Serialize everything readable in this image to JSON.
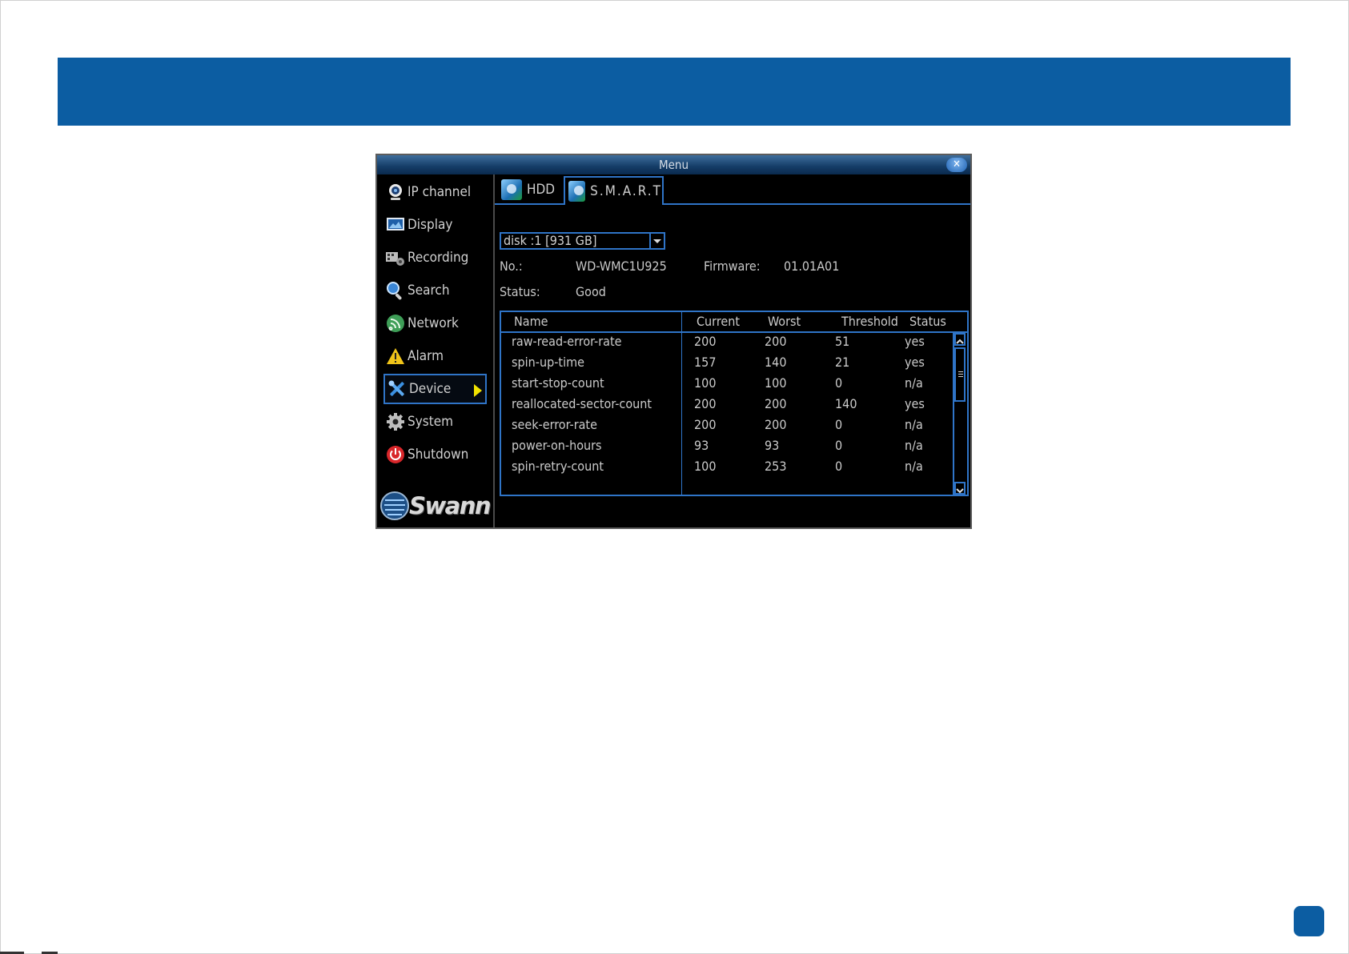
{
  "window": {
    "title": "Menu"
  },
  "sidebar": {
    "items": [
      {
        "label": "IP channel",
        "icon": "webcam-icon"
      },
      {
        "label": "Display",
        "icon": "monitor-icon"
      },
      {
        "label": "Recording",
        "icon": "film-icon"
      },
      {
        "label": "Search",
        "icon": "magnifier-icon"
      },
      {
        "label": "Network",
        "icon": "network-icon"
      },
      {
        "label": "Alarm",
        "icon": "warning-icon"
      },
      {
        "label": "Device",
        "icon": "tools-icon",
        "active": true
      },
      {
        "label": "System",
        "icon": "gear-icon"
      },
      {
        "label": "Shutdown",
        "icon": "power-icon"
      }
    ],
    "logo": "Swann"
  },
  "tabs": [
    {
      "label": "HDD",
      "active": false
    },
    {
      "label": "S.M.A.R.T",
      "active": true
    }
  ],
  "disk_select": {
    "value": "disk :1 [931 GB]"
  },
  "info": {
    "no_label": "No.:",
    "no_value": "WD-WMC1U925",
    "firmware_label": "Firmware:",
    "firmware_value": "01.01A01",
    "status_label": "Status:",
    "status_value": "Good"
  },
  "table": {
    "columns": [
      "Name",
      "Current",
      "Worst",
      "Threshold",
      "Status"
    ],
    "rows": [
      [
        "raw-read-error-rate",
        "200",
        "200",
        "51",
        "yes"
      ],
      [
        "spin-up-time",
        "157",
        "140",
        "21",
        "yes"
      ],
      [
        "start-stop-count",
        "100",
        "100",
        "0",
        "n/a"
      ],
      [
        "reallocated-sector-count",
        "200",
        "200",
        "140",
        "yes"
      ],
      [
        "seek-error-rate",
        "200",
        "200",
        "0",
        "n/a"
      ],
      [
        "power-on-hours",
        "93",
        "93",
        "0",
        "n/a"
      ],
      [
        "spin-retry-count",
        "100",
        "253",
        "0",
        "n/a"
      ]
    ]
  },
  "colors": {
    "header_band": "#0c5da2",
    "accent": "#2f74c7",
    "active_arrow": "#f2e200"
  }
}
